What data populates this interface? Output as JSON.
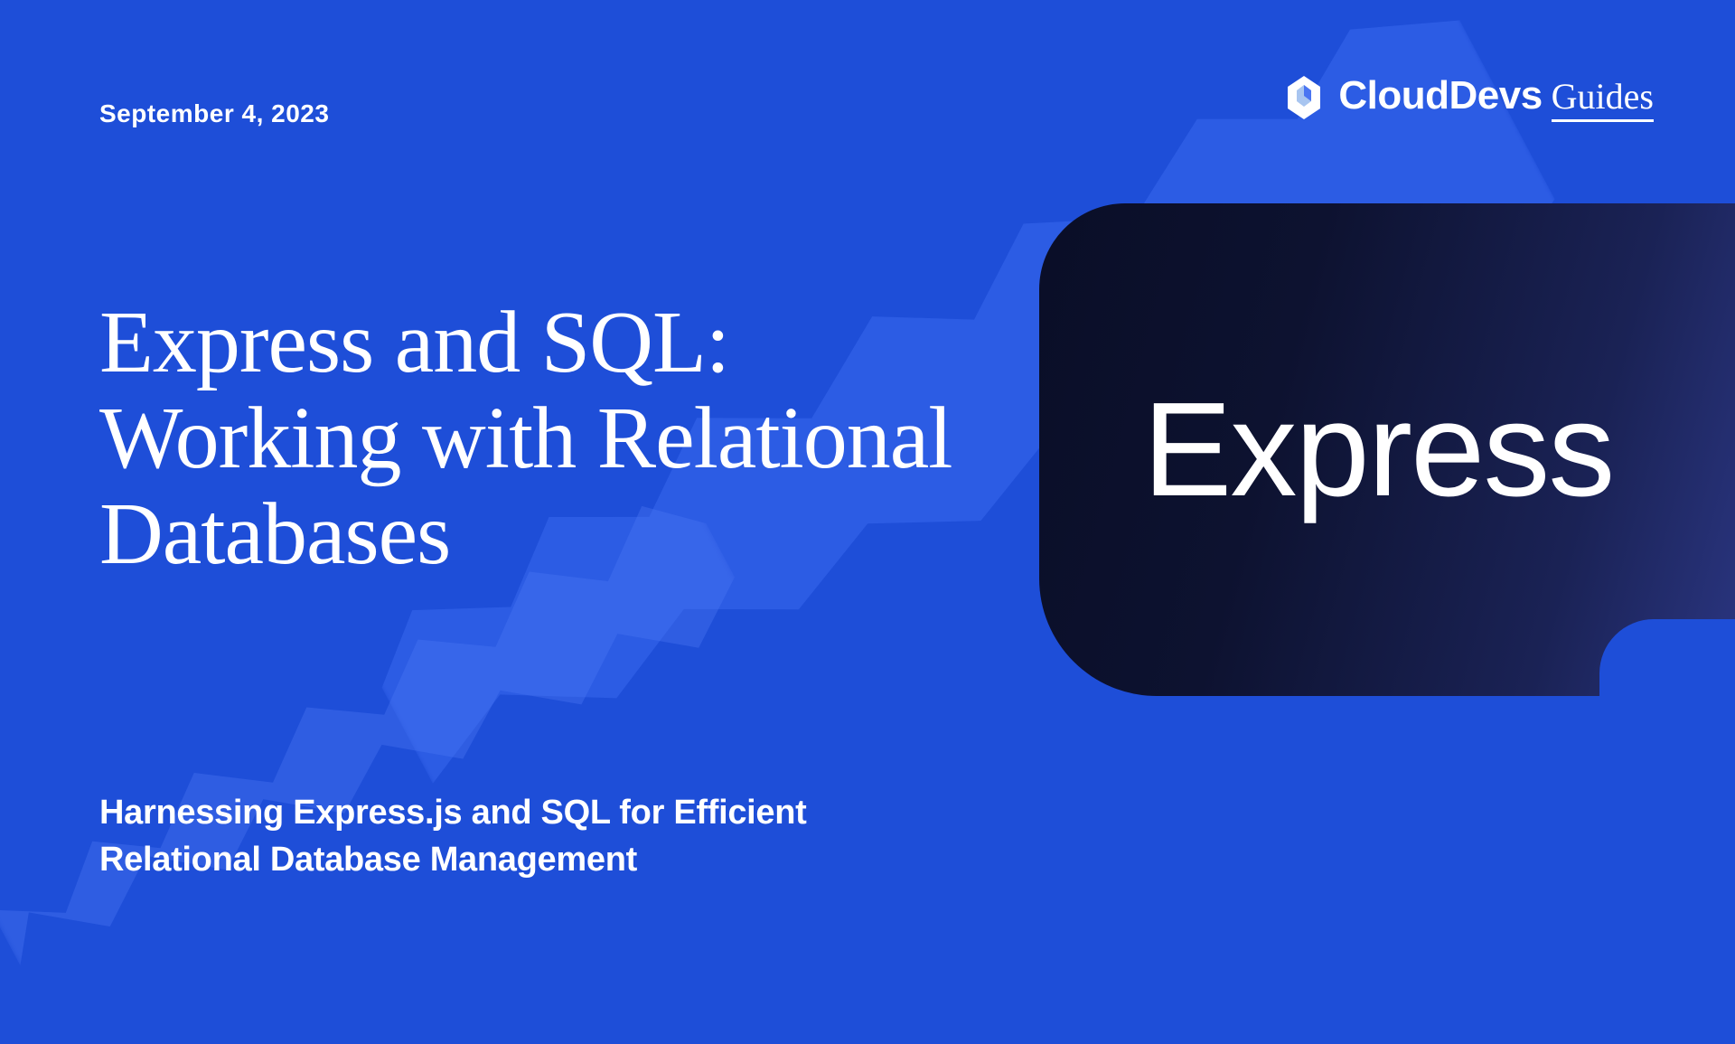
{
  "date": "September 4, 2023",
  "logo": {
    "brand": "CloudDevs",
    "section": "Guides"
  },
  "title": "Express and SQL: Working with Relational Databases",
  "subtitle": "Harnessing Express.js and SQL for Efficient Relational Database Management",
  "card": {
    "label": "Express"
  }
}
